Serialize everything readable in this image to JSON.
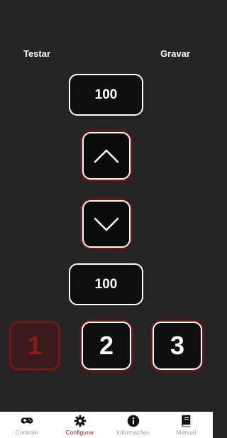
{
  "header": {
    "test_label": "Testar",
    "record_label": "Gravar"
  },
  "controls": {
    "top_value": "100",
    "bottom_value": "100",
    "up_icon": "chevron-up-icon",
    "down_icon": "chevron-down-icon"
  },
  "presets": [
    {
      "label": "1",
      "selected": true
    },
    {
      "label": "2",
      "selected": false
    },
    {
      "label": "3",
      "selected": false
    }
  ],
  "nav": {
    "items": [
      {
        "label": "Controle",
        "icon": "gamepad-icon",
        "active": false
      },
      {
        "label": "Configurar",
        "icon": "gear-icon",
        "active": true
      },
      {
        "label": "Informações",
        "icon": "info-icon",
        "active": false
      },
      {
        "label": "Manual",
        "icon": "book-icon",
        "active": false
      }
    ]
  },
  "colors": {
    "background": "#242424",
    "accent": "#8b1a1a",
    "button_fill": "#0f0f0f",
    "selected_preset_fill": "#3a1a1a",
    "nav_background": "#ffffff",
    "nav_inactive": "#9a9a9a"
  }
}
